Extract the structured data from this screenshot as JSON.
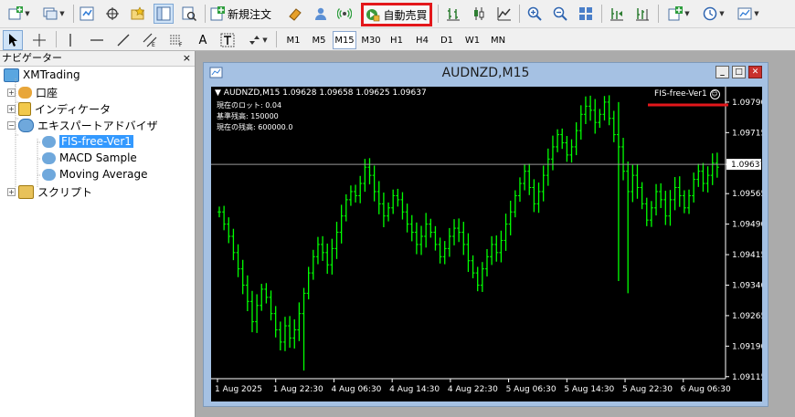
{
  "toolbar": {
    "new_order_label": "新規注文",
    "auto_trade_label": "自動売買",
    "highlight_color": "#e3171b",
    "timeframes": [
      "M1",
      "M5",
      "M15",
      "M30",
      "H1",
      "H4",
      "D1",
      "W1",
      "MN"
    ],
    "active_timeframe": "M15",
    "drawing_tools": [
      "cursor-icon",
      "crosshair-icon",
      "vertical-line-icon",
      "horizontal-line-icon",
      "trendline-icon",
      "equidistant-channel-icon",
      "fibonacci-icon",
      "text-icon",
      "text-label-icon",
      "arrows-icon"
    ],
    "text_tool_label": "A"
  },
  "navigator": {
    "title": "ナビゲーター",
    "close_label": "×",
    "root": "XMTrading",
    "items": [
      {
        "label": "口座",
        "expander": "+"
      },
      {
        "label": "インディケータ",
        "expander": "+"
      },
      {
        "label": "エキスパートアドバイザ",
        "expander": "−",
        "children": [
          "FIS-free-Ver1",
          "MACD Sample",
          "Moving Average"
        ]
      },
      {
        "label": "スクリプト",
        "expander": "+"
      }
    ],
    "selected": "FIS-free-Ver1"
  },
  "chart_window": {
    "title": "AUDNZD,M15",
    "symbol_line": "AUDNZD,M15  1.09628 1.09658 1.09625 1.09637",
    "info_lines": [
      "現在のロット: 0.04",
      "基準残高: 150000",
      "現在の残高: 600000.0"
    ],
    "ea_label": "FIS-free-Ver1",
    "underline_color": "#e3171b",
    "price_label": "1.09637"
  },
  "chart_data": {
    "type": "bar",
    "symbol": "AUDNZD",
    "timeframe": "M15",
    "ohlc_current": {
      "open": 1.09628,
      "high": 1.09658,
      "low": 1.09625,
      "close": 1.09637
    },
    "y_ticks": [
      "1.09790",
      "1.09715",
      "1.09637",
      "1.09565",
      "1.09490",
      "1.09415",
      "1.09340",
      "1.09265",
      "1.09190",
      "1.09115"
    ],
    "ylim": [
      1.0911,
      1.0981
    ],
    "x_ticks": [
      "1 Aug 2025",
      "1 Aug 22:30",
      "4 Aug 06:30",
      "4 Aug 14:30",
      "4 Aug 22:30",
      "5 Aug 06:30",
      "5 Aug 14:30",
      "5 Aug 22:30",
      "6 Aug 06:30"
    ],
    "bar_color": "#00ff00",
    "background": "#000000",
    "closes": [
      1.0952,
      1.0949,
      1.0946,
      1.0942,
      1.0938,
      1.0934,
      1.093,
      1.0925,
      1.0929,
      1.0933,
      1.0931,
      1.0927,
      1.0923,
      1.092,
      1.0924,
      1.0921,
      1.0923,
      1.0927,
      1.0932,
      1.0937,
      1.0941,
      1.0944,
      1.0942,
      1.0939,
      1.0943,
      1.0947,
      1.0951,
      1.0955,
      1.0957,
      1.0956,
      1.0959,
      1.0963,
      1.0961,
      1.0957,
      1.0954,
      1.0951,
      1.0953,
      1.0956,
      1.0955,
      1.0952,
      1.0949,
      1.0947,
      1.0944,
      1.0946,
      1.0949,
      1.0947,
      1.0944,
      1.0941,
      1.0943,
      1.0946,
      1.0948,
      1.0947,
      1.0944,
      1.094,
      1.0937,
      1.0934,
      1.0938,
      1.0941,
      1.0944,
      1.0942,
      1.0945,
      1.0949,
      1.0952,
      1.0956,
      1.0959,
      1.0962,
      1.0958,
      1.0954,
      1.0957,
      1.0961,
      1.0965,
      1.0968,
      1.0971,
      1.0969,
      1.0966,
      1.0968,
      1.0972,
      1.0976,
      1.0978,
      1.0977,
      1.0974,
      1.0976,
      1.0979,
      1.0975,
      1.0971,
      1.0968,
      1.0962,
      1.0957,
      1.0961,
      1.0958,
      1.0954,
      1.095,
      1.0953,
      1.0957,
      1.0955,
      1.0951,
      1.0955,
      1.0958,
      1.0956,
      1.0953,
      1.0956,
      1.096,
      1.0962,
      1.0959,
      1.0961,
      1.0964,
      1.0963
    ]
  }
}
